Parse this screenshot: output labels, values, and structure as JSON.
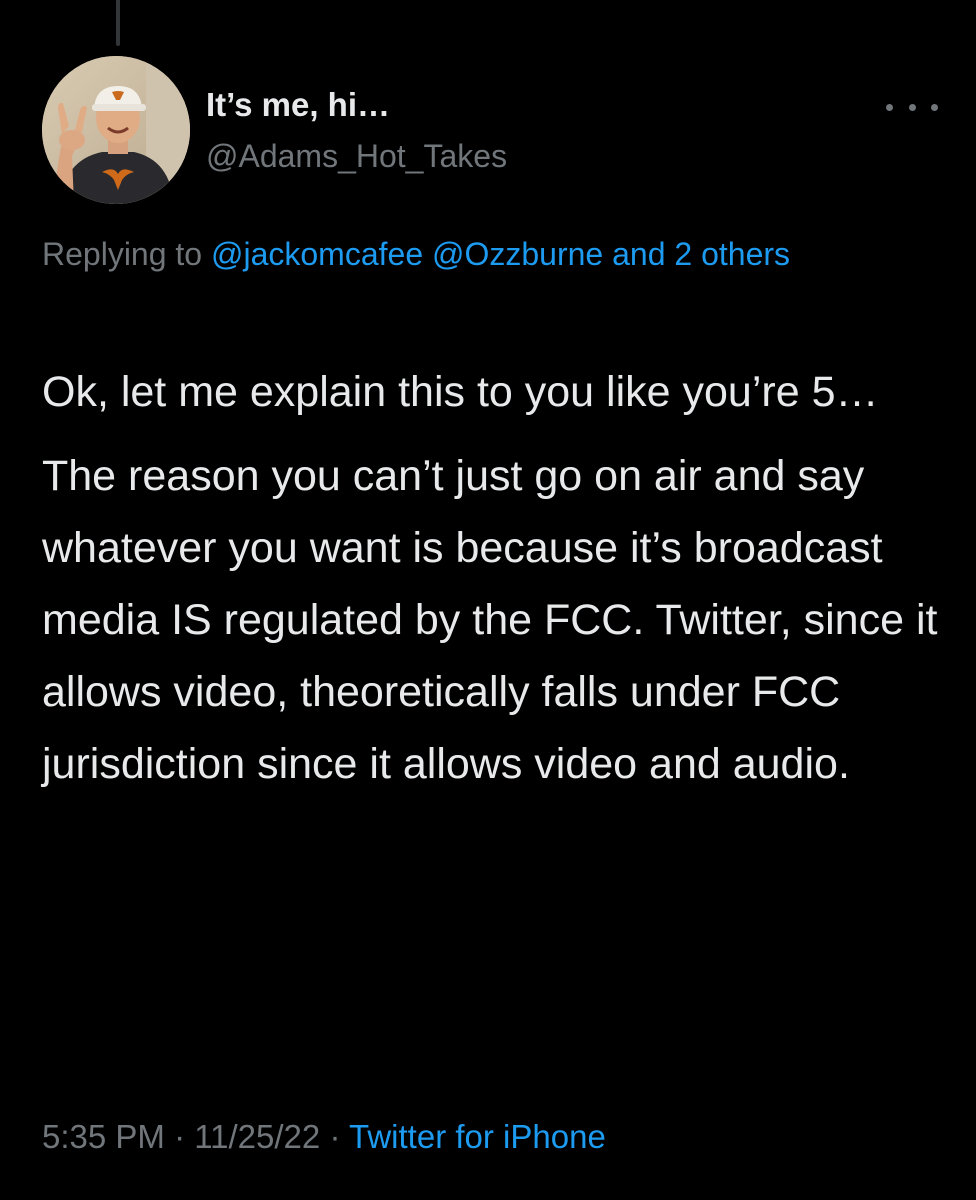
{
  "colors": {
    "background": "#000000",
    "text_primary": "#e7e9ea",
    "text_secondary": "#71767b",
    "accent_link": "#1d9bf0",
    "thread_line": "#333639"
  },
  "thread": {
    "connector_icon": "thread-line"
  },
  "author": {
    "display_name": "It’s me, hi…",
    "handle": "@Adams_Hot_Takes",
    "avatar_icon": "avatar-photo"
  },
  "more_menu": {
    "icon": "more-horizontal-icon"
  },
  "reply_context": {
    "prefix": "Replying to",
    "mention_1": "@jackomcafee",
    "mention_2": "@Ozzburne",
    "others": "and 2 others"
  },
  "tweet": {
    "paragraph_1": "Ok, let me explain this to you like you’re 5…",
    "paragraph_2": "The reason you can’t just go on air and say whatever you want is because it’s broadcast media IS regulated by the FCC. Twitter, since it allows video, theoretically falls under FCC jurisdiction since it allows video and audio."
  },
  "meta": {
    "time": "5:35 PM",
    "separator": "·",
    "date": "11/25/22",
    "source": "Twitter for iPhone"
  }
}
